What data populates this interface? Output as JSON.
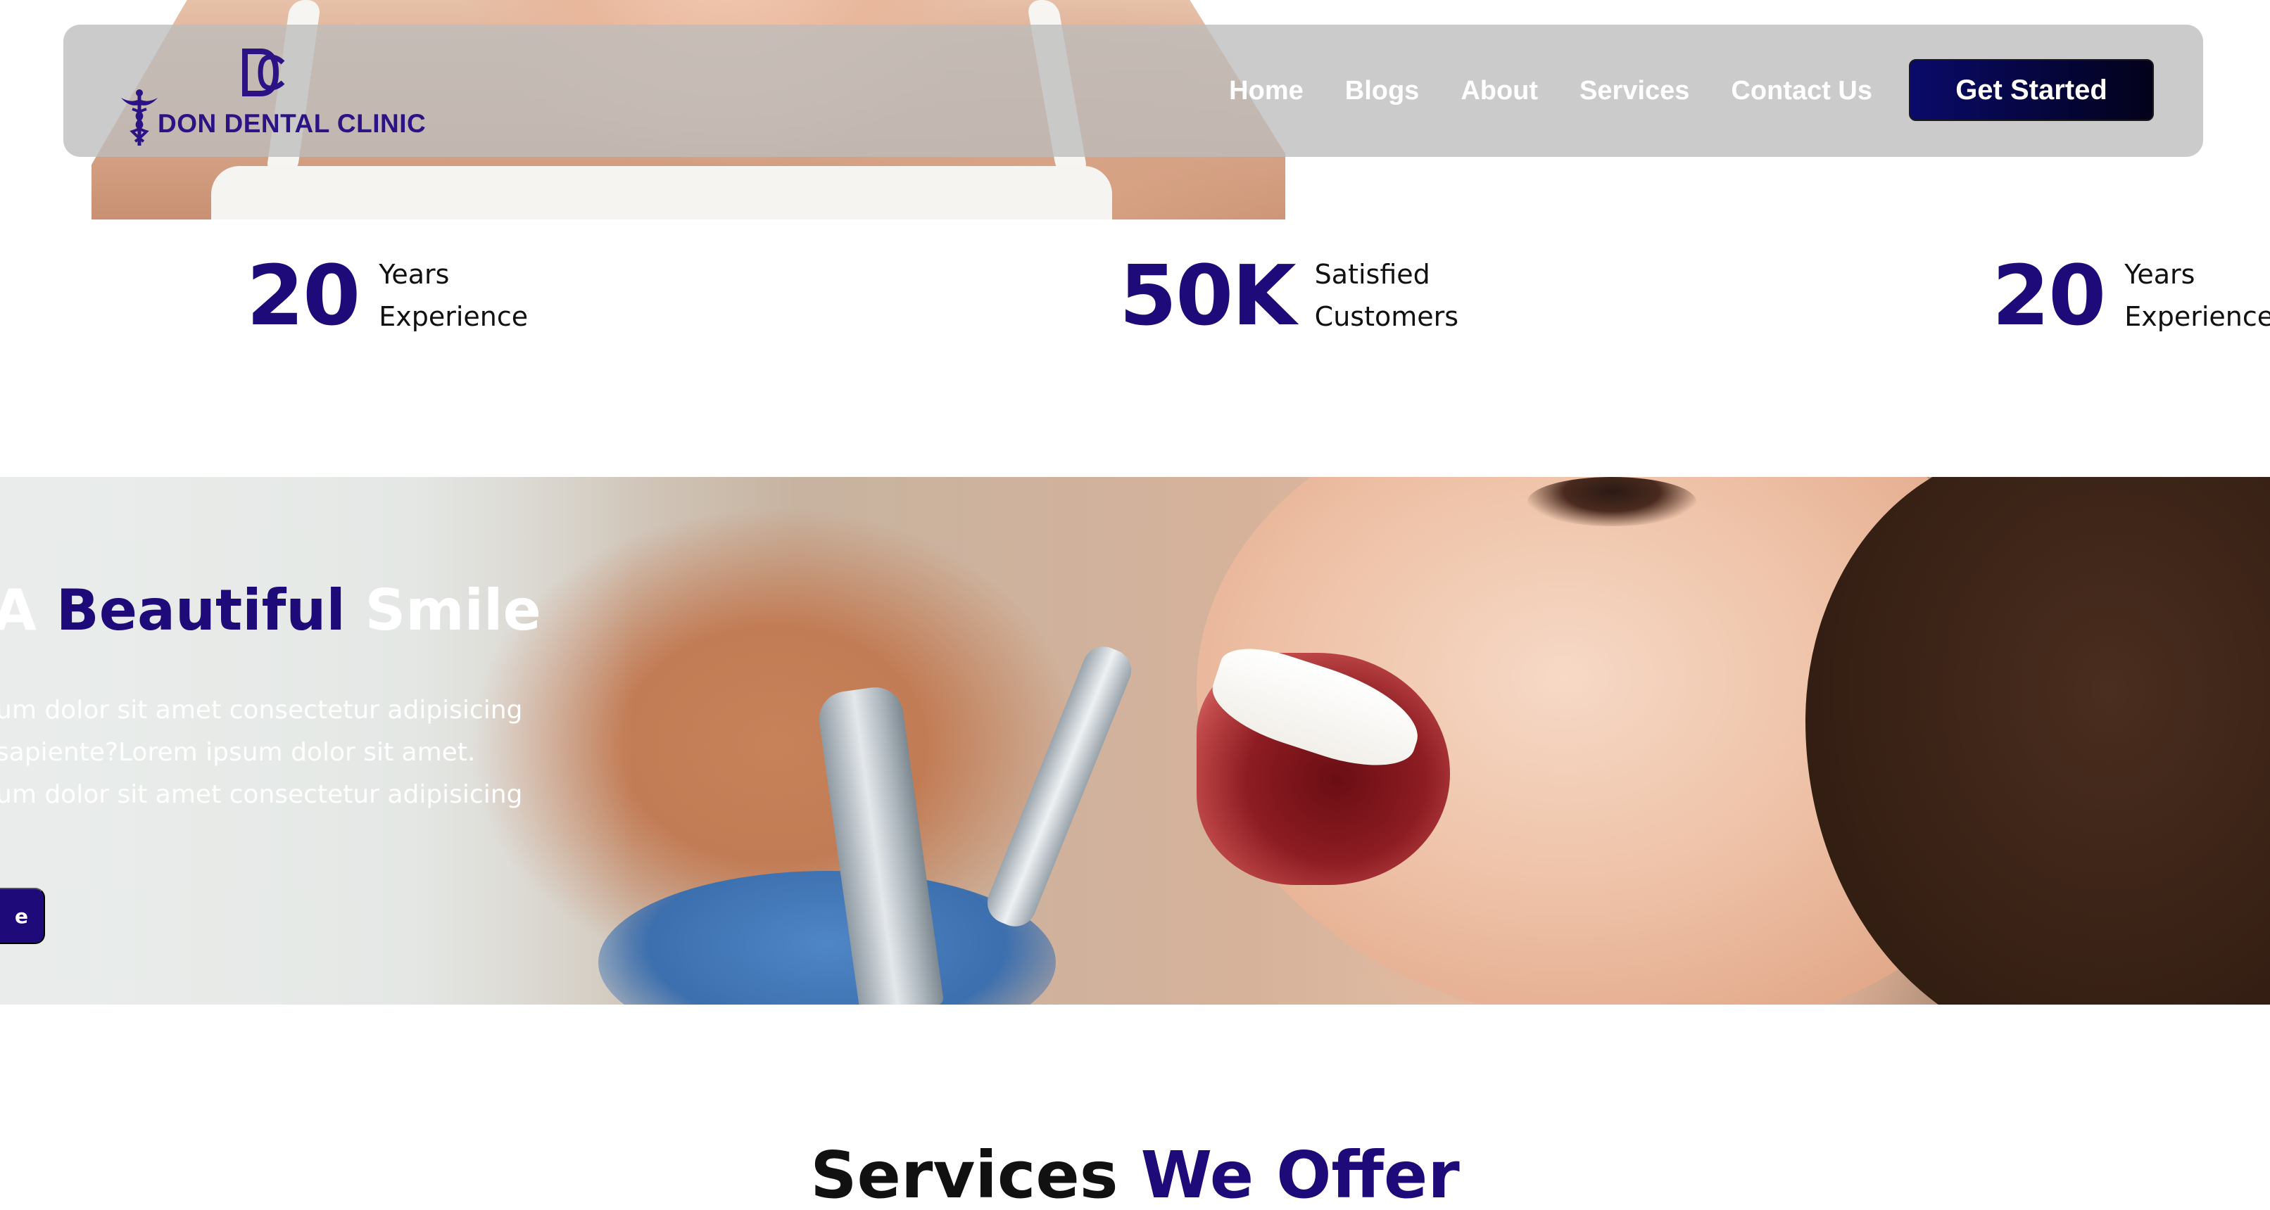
{
  "nav": {
    "logo_text": "DON DENTAL CLINIC",
    "links": [
      "Home",
      "Blogs",
      "About",
      "Services",
      "Contact Us"
    ],
    "cta": "Get Started"
  },
  "stats": [
    {
      "value": "20",
      "label_1": "Years",
      "label_2": "Experience"
    },
    {
      "value": "50K",
      "label_1": "Satisfied",
      "label_2": "Customers"
    },
    {
      "value": "20",
      "label_1": "Years",
      "label_2": "Experience"
    }
  ],
  "banner": {
    "title_1": "A",
    "title_2": "Beautiful",
    "title_3": "Smile",
    "text_lines": [
      "um dolor sit amet consectetur adipisicing",
      "sapiente?Lorem ipsum dolor sit amet.",
      "um dolor sit amet consectetur adipisicing"
    ],
    "button": "e"
  },
  "services": {
    "title_1": "Services",
    "title_2": "We Offer"
  },
  "colors": {
    "brand": "#1e0a78",
    "nav_bg": "#bcbcbc",
    "cta_bg": "#05053a"
  }
}
